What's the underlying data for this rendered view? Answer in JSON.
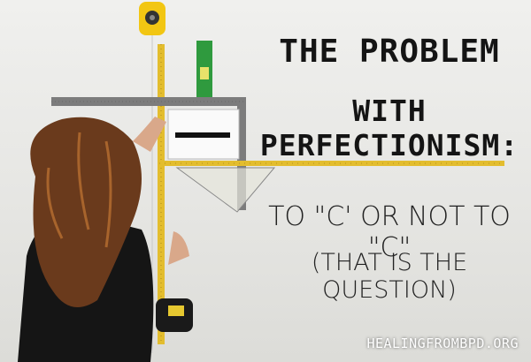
{
  "headline": {
    "line1": "THE PROBLEM",
    "line2": "WITH PERFECTIONISM:"
  },
  "subheadline": {
    "line1": "TO \"C' OR NOT TO \"C\"",
    "line2": "(THAT IS THE QUESTION)"
  },
  "credit": "HEALINGFROMBPD.ORG",
  "colors": {
    "tape": "#e3bd2e",
    "level": "#2f9a3e",
    "square": "#7c7c7c",
    "hair": "#6a3a1c",
    "shirt": "#151515"
  }
}
